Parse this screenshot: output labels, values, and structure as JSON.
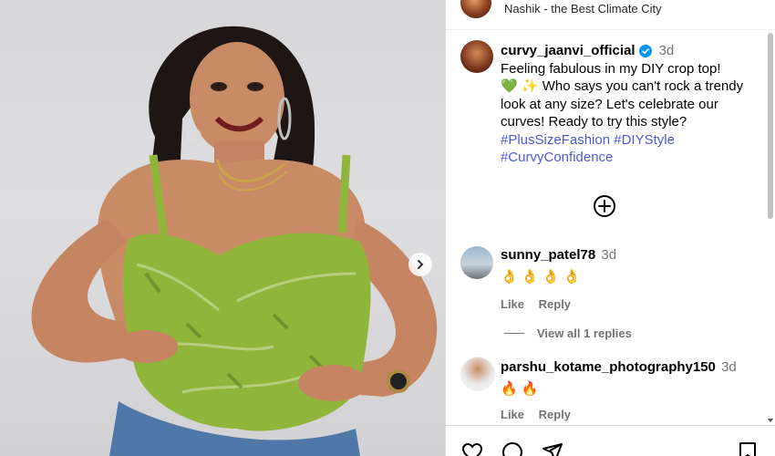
{
  "location": {
    "text": "Nashik - the Best Climate City"
  },
  "post": {
    "username": "curvy_jaanvi_official",
    "age": "3d",
    "caption_lines": [
      "Feeling fabulous in my DIY crop top!",
      "💚 ✨  Who says you can't rock a trendy",
      "look at any size? Let's celebrate our",
      "curves! Ready to try this style?"
    ],
    "hashtags": [
      "#PlusSizeFashion",
      "#DIYStyle",
      "#CurvyConfidence"
    ]
  },
  "comments": [
    {
      "username": "sunny_patel78",
      "age": "3d",
      "text": "👌 👌 👌 👌",
      "like_label": "Like",
      "reply_label": "Reply",
      "view_replies": "View all 1 replies"
    },
    {
      "username": "parshu_kotame_photography150",
      "age": "3d",
      "text": "🔥 🔥",
      "like_label": "Like",
      "reply_label": "Reply"
    }
  ],
  "colors": {
    "verified": "#0095f6",
    "hashtag": "#4f5bd5",
    "muted": "#737373",
    "divider": "#dbdbdb"
  },
  "icons": [
    "add-circle-icon",
    "verified-icon",
    "next-arrow-icon",
    "heart-icon",
    "comment-icon",
    "share-icon",
    "bookmark-icon"
  ]
}
